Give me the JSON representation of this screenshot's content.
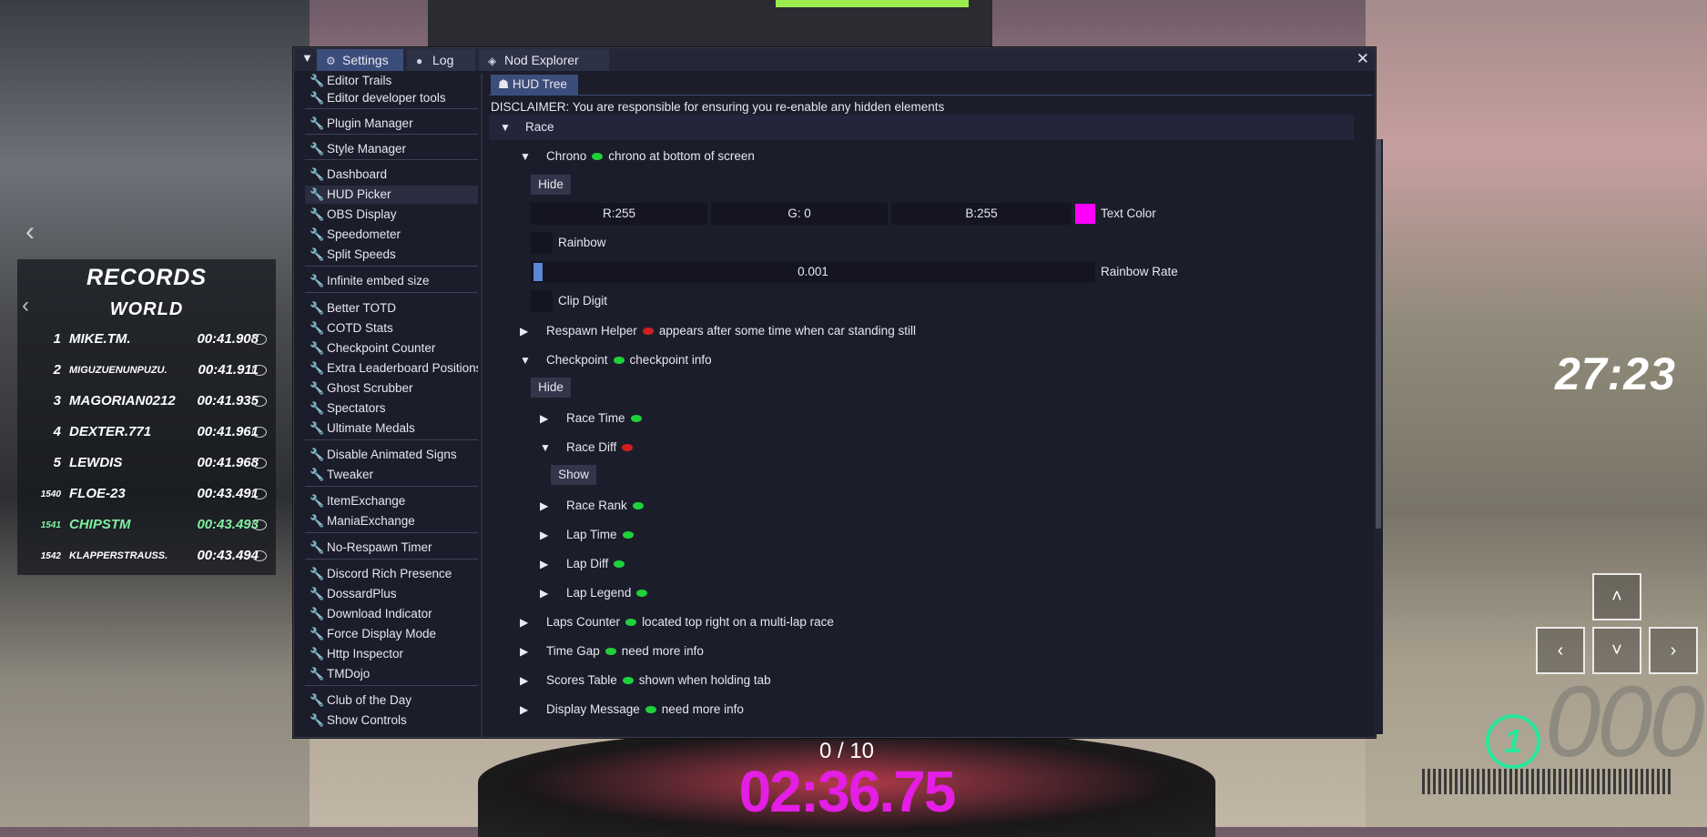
{
  "window": {
    "tabs": [
      {
        "label": "Settings",
        "icon": "gear-icon"
      },
      {
        "label": "Log",
        "icon": "speech-bubble-icon"
      },
      {
        "label": "Nod Explorer",
        "icon": "cube-icon"
      }
    ],
    "close": "✕",
    "menu_icon": "▼"
  },
  "sidebar": {
    "items": [
      "Editor Trails",
      "Editor developer tools",
      "Plugin Manager",
      "Style Manager",
      "Dashboard",
      "HUD Picker",
      "OBS Display",
      "Speedometer",
      "Split Speeds",
      "Infinite embed size",
      "Better TOTD",
      "COTD Stats",
      "Checkpoint Counter",
      "Extra Leaderboard Positions",
      "Ghost Scrubber",
      "Spectators",
      "Ultimate Medals",
      "Disable Animated Signs",
      "Tweaker",
      "ItemExchange",
      "ManiaExchange",
      "No-Respawn Timer",
      "Discord Rich Presence",
      "DossardPlus",
      "Download Indicator",
      "Force Display Mode",
      "Http Inspector",
      "TMDojo",
      "Club of the Day",
      "Show Controls"
    ],
    "active": "HUD Picker"
  },
  "content": {
    "subtab": "HUD Tree",
    "disclaimer": "DISCLAIMER: You are responsible for ensuring you re-enable any hidden elements",
    "race": "Race",
    "chrono": {
      "label": "Chrono",
      "desc": "chrono at bottom of screen"
    },
    "hide": "Hide",
    "show": "Show",
    "color": {
      "r": "R:255",
      "g": "G:  0",
      "b": "B:255",
      "label": "Text Color",
      "swatch": "#ff00ff"
    },
    "rainbow": "Rainbow",
    "rainbow_rate": {
      "value": "0.001",
      "label": "Rainbow Rate"
    },
    "clip_digit": "Clip Digit",
    "respawn": {
      "label": "Respawn Helper",
      "desc": "appears after some time when car standing still"
    },
    "checkpoint": {
      "label": "Checkpoint",
      "desc": "checkpoint info"
    },
    "race_time": "Race Time",
    "race_diff": "Race Diff",
    "race_rank": "Race Rank",
    "lap_time": "Lap Time",
    "lap_diff": "Lap Diff",
    "lap_legend": "Lap Legend",
    "laps_counter": {
      "label": "Laps Counter",
      "desc": "located top right on a multi-lap race"
    },
    "time_gap": {
      "label": "Time Gap",
      "desc": "need more info"
    },
    "scores_table": {
      "label": "Scores Table",
      "desc": "shown when holding tab"
    },
    "display_message": {
      "label": "Display Message",
      "desc": "need more info"
    }
  },
  "records": {
    "title": "RECORDS",
    "subtitle": "WORLD",
    "rows": [
      {
        "rank": "1",
        "name": "MIKE.TM.",
        "time": "00:41.908"
      },
      {
        "rank": "2",
        "name": "MIGUZUENUNPUZU.",
        "time": "00:41.911"
      },
      {
        "rank": "3",
        "name": "MAGORIAN0212",
        "time": "00:41.935"
      },
      {
        "rank": "4",
        "name": "DEXTER.771",
        "time": "00:41.961"
      },
      {
        "rank": "5",
        "name": "LEWDIS",
        "time": "00:41.968"
      },
      {
        "rank": "1540",
        "name": "FLOE-23",
        "time": "00:43.491"
      },
      {
        "rank": "1541",
        "name": "CHIPSTM",
        "time": "00:43.493"
      },
      {
        "rank": "1542",
        "name": "KLAPPERSTRAUSS.",
        "time": "00:43.494"
      }
    ]
  },
  "hud": {
    "clock": "27:23",
    "gear": "1",
    "speed": "000",
    "checkpoints": "0 / 10",
    "race_time": "02:36.75",
    "arrow_up": "˄",
    "arrow_left": "‹",
    "arrow_down": "˅",
    "arrow_right": "›"
  }
}
